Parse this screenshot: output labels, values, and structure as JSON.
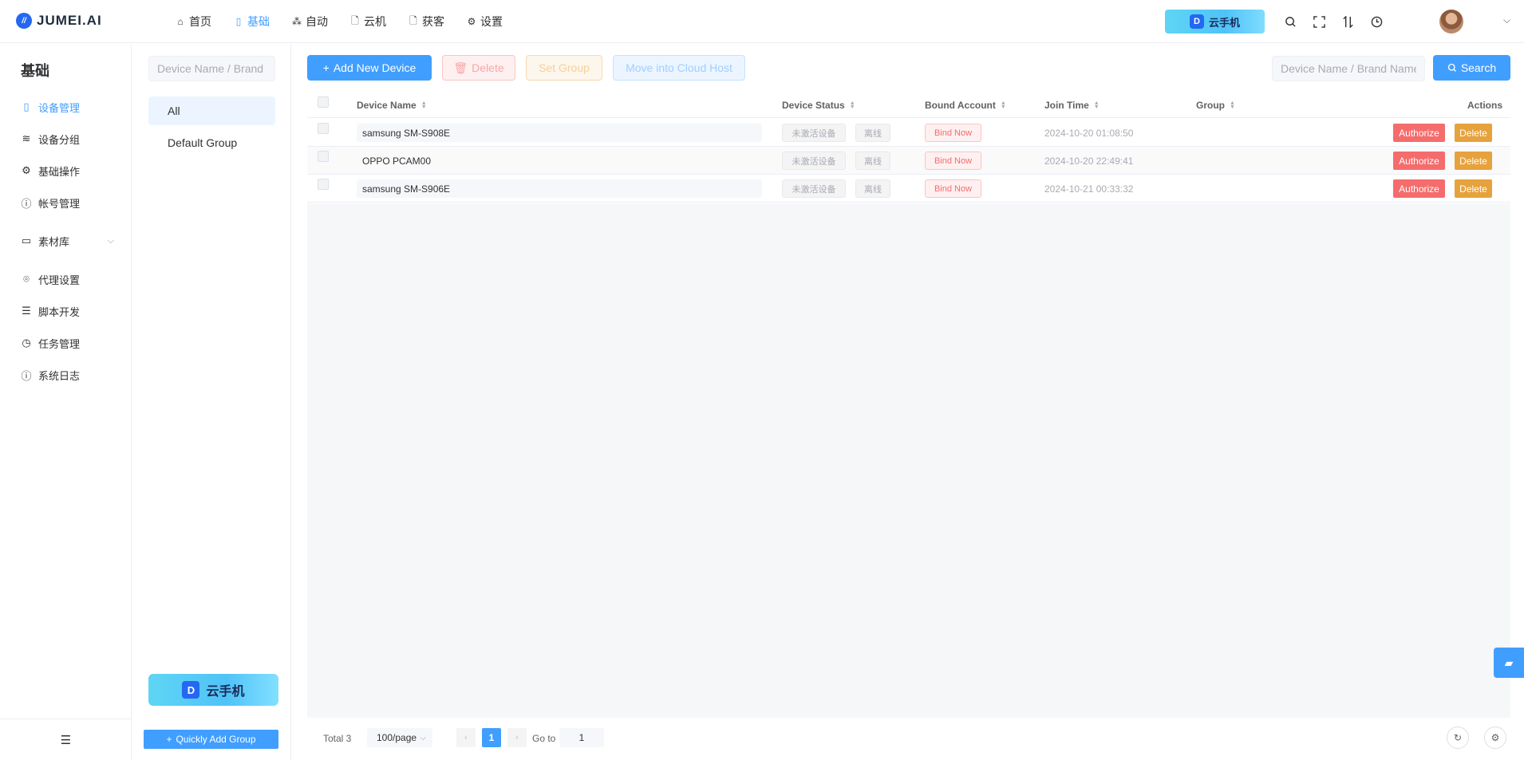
{
  "app": {
    "logo_text": "JUMEI.AI",
    "logo_mark": "//"
  },
  "topnav": {
    "items": [
      {
        "label": "首页",
        "icon": "home-icon",
        "glyph": "⌂"
      },
      {
        "label": "基础",
        "icon": "phone-icon",
        "glyph": "▯"
      },
      {
        "label": "自动",
        "icon": "flow-icon",
        "glyph": "⁂"
      },
      {
        "label": "云机",
        "icon": "doc-icon",
        "glyph": "🗋"
      },
      {
        "label": "获客",
        "icon": "doc-icon",
        "glyph": "🗋"
      },
      {
        "label": "设置",
        "icon": "gear-icon",
        "glyph": "⚙"
      }
    ],
    "active_index": 1
  },
  "promo": {
    "label": "云手机",
    "badge": "D"
  },
  "top_tools": [
    "search-icon",
    "fullscreen-icon",
    "switch-icon",
    "clock-icon"
  ],
  "sidebar": {
    "title": "基础",
    "items": [
      {
        "label": "设备管理",
        "icon": "device-icon",
        "glyph": "▯"
      },
      {
        "label": "设备分组",
        "icon": "layers-icon",
        "glyph": "≋"
      },
      {
        "label": "基础操作",
        "icon": "gear-icon",
        "glyph": "⚙"
      },
      {
        "label": "帐号管理",
        "icon": "info-icon",
        "glyph": "ⓘ"
      },
      {
        "label": "素材库",
        "icon": "folder-icon",
        "glyph": "▭"
      },
      {
        "label": "代理设置",
        "icon": "location-icon",
        "glyph": "⌾"
      },
      {
        "label": "脚本开发",
        "icon": "script-icon",
        "glyph": "☰"
      },
      {
        "label": "任务管理",
        "icon": "alarm-icon",
        "glyph": "◷"
      },
      {
        "label": "系统日志",
        "icon": "info-icon",
        "glyph": "ⓘ"
      }
    ],
    "active_index": 0,
    "collapse_glyph": "☰"
  },
  "groups": {
    "search_placeholder": "Device Name / Brand",
    "items": [
      "All",
      "Default Group"
    ],
    "active_index": 0,
    "quick_add_label": "Quickly Add Group"
  },
  "toolbar": {
    "add_label": "Add New Device",
    "delete_label": "Delete",
    "set_group_label": "Set Group",
    "cloud_label": "Move into Cloud Host",
    "search_placeholder": "Device Name / Brand Name",
    "search_label": "Search"
  },
  "table": {
    "columns": {
      "name": "Device Name",
      "status": "Device Status",
      "account": "Bound Account",
      "join": "Join Time",
      "group": "Group",
      "actions": "Actions"
    },
    "rows": [
      {
        "name": "samsung SM-S908E",
        "status": "未激活设备",
        "online": "离线",
        "bind": "Bind Now",
        "time": "2024-10-20 01:08:50",
        "group": "",
        "authorize": "Authorize",
        "delete": "Delete"
      },
      {
        "name": "OPPO PCAM00",
        "status": "未激活设备",
        "online": "离线",
        "bind": "Bind Now",
        "time": "2024-10-20 22:49:41",
        "group": "",
        "authorize": "Authorize",
        "delete": "Delete"
      },
      {
        "name": "samsung SM-S906E",
        "status": "未激活设备",
        "online": "离线",
        "bind": "Bind Now",
        "time": "2024-10-21 00:33:32",
        "group": "",
        "authorize": "Authorize",
        "delete": "Delete"
      }
    ]
  },
  "pagination": {
    "total": "Total 3",
    "page_size": "100/page",
    "current_page": "1",
    "goto_label": "Go to",
    "goto_value": "1"
  },
  "colors": {
    "primary": "#409eff",
    "danger": "#f56c6c",
    "warning": "#e6a23c"
  }
}
